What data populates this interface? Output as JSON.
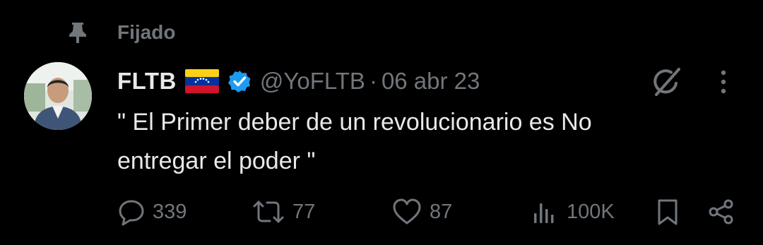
{
  "pinned": {
    "label": "Fijado",
    "icon": "pin-icon"
  },
  "tweet": {
    "author_name": "FLTB",
    "flag": "venezuela-flag-icon",
    "verified": "verified-badge-icon",
    "handle": "@YoFLTB",
    "separator": "·",
    "date": "06 abr 23",
    "text_line1": "\" El Primer deber de un revolucionario es No",
    "text_line2": "entregar el poder \""
  },
  "actions": {
    "replies": "339",
    "reposts": "77",
    "likes": "87",
    "views": "100K"
  },
  "colors": {
    "background": "#000000",
    "text": "#e7e9ea",
    "muted": "#71767b",
    "verified": "#1d9bf0"
  }
}
